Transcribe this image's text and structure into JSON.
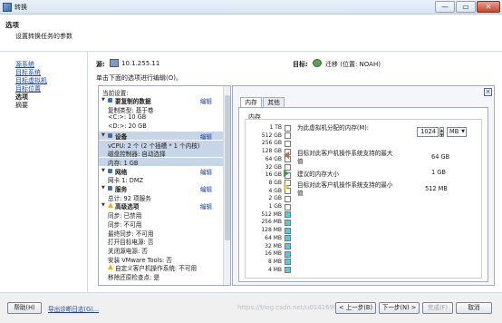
{
  "window": {
    "title": "转换",
    "min": "—",
    "max": "▭",
    "close": "✕"
  },
  "header": {
    "title": "选项",
    "subtitle": "设置转换任务的参数"
  },
  "nav": {
    "items": [
      {
        "label": "源系统",
        "link": true
      },
      {
        "label": "目标系统",
        "link": true
      },
      {
        "label": "目标虚拟机",
        "link": true
      },
      {
        "label": "目标位置",
        "link": true
      },
      {
        "label": "选项",
        "link": false,
        "bold": true
      },
      {
        "label": "摘要",
        "link": false,
        "bold": false
      }
    ]
  },
  "source": {
    "label": "源:",
    "value": "10.1.255.11"
  },
  "target": {
    "label": "目标:",
    "value": "迁移 (位置: NOAH)"
  },
  "instruction": "单击下面的选项进行编辑(O)。",
  "settings": {
    "header": "当前设置:",
    "edit": "编辑",
    "rows": [
      {
        "text": "要复制的数据",
        "type": "section",
        "edit": true,
        "sel": false
      },
      {
        "text": "复制类型: 基于卷",
        "type": "item",
        "sel": false
      },
      {
        "text": "<C:>: 10 GB",
        "type": "item",
        "sel": false
      },
      {
        "text": "<D:>: 20 GB",
        "type": "item",
        "sel": false
      },
      {
        "text": "设备",
        "type": "section",
        "edit": true,
        "sel": true
      },
      {
        "text": "vCPU: 2 个 (2 个插槽 * 1 个内核)",
        "type": "item",
        "sel": true
      },
      {
        "text": "磁盘控制器: 自动选择",
        "type": "item",
        "sel": true
      },
      {
        "text": "内存: 1 GB",
        "type": "item",
        "sel": true
      },
      {
        "text": "网络",
        "type": "section",
        "edit": true,
        "sel": false
      },
      {
        "text": "网卡 1: DMZ",
        "type": "item",
        "sel": false
      },
      {
        "text": "服务",
        "type": "section",
        "edit": true,
        "sel": false
      },
      {
        "text": "总计: 92 项服务",
        "type": "item",
        "sel": false
      },
      {
        "text": "高级选项",
        "type": "warn-section",
        "edit": true,
        "sel": false
      },
      {
        "text": "同步: 已禁用",
        "type": "item",
        "sel": false
      },
      {
        "text": "同步: 不可用",
        "type": "item",
        "sel": false
      },
      {
        "text": "最终同步: 不可用",
        "type": "item",
        "sel": false
      },
      {
        "text": "打开目标电源: 否",
        "type": "item",
        "sel": false
      },
      {
        "text": "关闭源电源: 否",
        "type": "item",
        "sel": false
      },
      {
        "text": "安装 VMware Tools: 否",
        "type": "item",
        "sel": false
      },
      {
        "text": "自定义客户机操作系统: 不可用",
        "type": "warn-item",
        "sel": false
      },
      {
        "text": "移除还原检查点: 是",
        "type": "item",
        "sel": false
      }
    ]
  },
  "memory": {
    "tabs": [
      "内存",
      "其他"
    ],
    "group_label": "内存",
    "alloc_label": "为此虚拟机分配的内存(M):",
    "alloc_value": "1024",
    "unit": "MB",
    "scale": [
      "1 TB",
      "512 GB",
      "256 GB",
      "128 GB",
      "64 GB",
      "32 GB",
      "16 GB",
      "8 GB",
      "4 GB",
      "2 GB",
      "1 GB",
      "512 MB",
      "256 MB",
      "128 MB",
      "64 MB",
      "32 MB",
      "16 MB",
      "8 MB",
      "4 MB"
    ],
    "legend": [
      {
        "label": "目标对此客户机操作系统支持的最大值",
        "value": "64 GB",
        "color": "#c0704a"
      },
      {
        "label": "建议的内存大小",
        "value": "1 GB",
        "color": "#3aa13a"
      },
      {
        "label": "目标对此客户机操作系统支持的最小值",
        "value": "512 MB",
        "color": "#e6d23a"
      }
    ]
  },
  "footer": {
    "help": "帮助(H)",
    "export": "导出诊断日志(G)...",
    "back": "< 上一步(B)",
    "next": "下一步(N) >",
    "finish": "完成(F)",
    "cancel": "取消"
  },
  "watermark": "https://blog.csdn.net/u014169032"
}
